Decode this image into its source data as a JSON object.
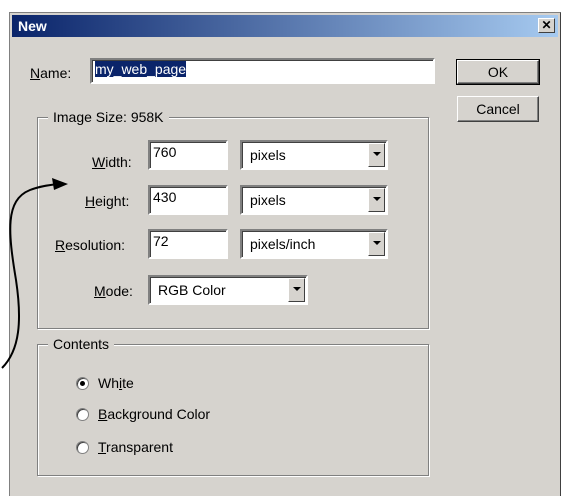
{
  "window": {
    "title": "New",
    "close_glyph": "✕"
  },
  "name": {
    "label_prefix": "",
    "label_ul": "N",
    "label_rest": "ame:",
    "value": "my_web_page"
  },
  "buttons": {
    "ok": "OK",
    "cancel": "Cancel"
  },
  "image_size": {
    "legend": "Image Size:  958K",
    "width": {
      "ul": "W",
      "rest": "idth:",
      "value": "760",
      "unit": "pixels"
    },
    "height": {
      "ul": "H",
      "rest": "eight:",
      "value": "430",
      "unit": "pixels"
    },
    "resolution": {
      "ul": "R",
      "rest": "esolution:",
      "value": "72",
      "unit": "pixels/inch"
    },
    "mode": {
      "ul": "M",
      "rest": "ode:",
      "value": "RGB Color"
    }
  },
  "contents": {
    "legend": "Contents",
    "options": [
      {
        "pre": "Wh",
        "ul": "i",
        "post": "te",
        "selected": true
      },
      {
        "pre": "",
        "ul": "B",
        "post": "ackground Color",
        "selected": false
      },
      {
        "pre": "",
        "ul": "T",
        "post": "ransparent",
        "selected": false
      }
    ]
  },
  "colors": {
    "title_start": "#0a246a",
    "title_end": "#a6caf0",
    "dialog_bg": "#d6d3ce"
  }
}
